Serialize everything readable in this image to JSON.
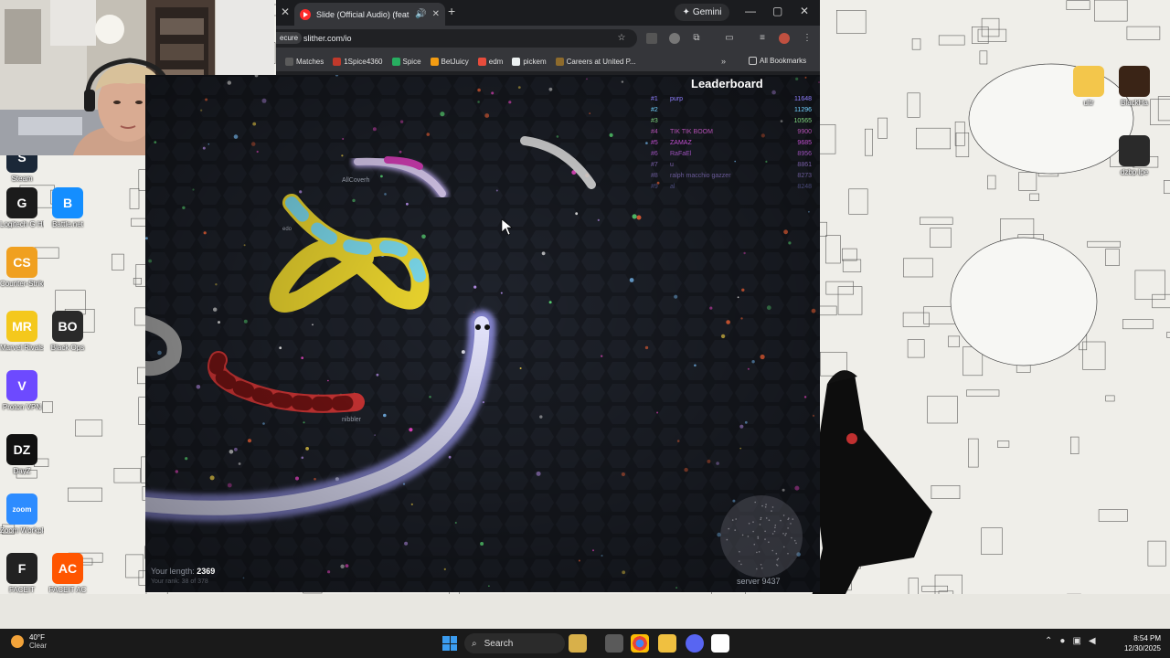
{
  "webcam": {
    "label": "webcam overlay"
  },
  "desktop_icons": [
    {
      "label": "Steam",
      "color": "#1b2838",
      "glyph": "S"
    },
    {
      "label": "Logitech G HUB",
      "color": "#1b1b1b",
      "glyph": "G"
    },
    {
      "label": "Battle.net",
      "color": "#148eff",
      "glyph": "B"
    },
    {
      "label": "Counter-Strike 2",
      "color": "#f0a020",
      "glyph": "CS"
    },
    {
      "label": "Marvel Rivals",
      "color": "#f4c81c",
      "glyph": "MR"
    },
    {
      "label": "Black Ops",
      "color": "#2a2a2a",
      "glyph": "BO"
    },
    {
      "label": "Proton VPN",
      "color": "#6d4aff",
      "glyph": "V"
    },
    {
      "label": "DayZ",
      "color": "#111111",
      "glyph": "DZ"
    },
    {
      "label": "Zoom Workplace",
      "color": "#2d8cff",
      "glyph": "zoom"
    },
    {
      "label": "FACEIT",
      "color": "#222222",
      "glyph": "F"
    },
    {
      "label": "FACEIT AC",
      "color": "#ff5500",
      "glyph": "AC"
    }
  ],
  "right_icons": [
    {
      "label": "ultr",
      "color": "#f3c64b"
    },
    {
      "label": "BlackHa",
      "color": "#3a2416"
    },
    {
      "label": "dzbp.lpe",
      "color": "#2a2a2a"
    }
  ],
  "browser": {
    "tab_title": "Slide (Official Audio) (feat.",
    "gemini_label": "Gemini",
    "not_secure": "ecure",
    "url": "slither.com/io",
    "bookmarks": [
      {
        "label": "Matches",
        "color": "#5b5b5b"
      },
      {
        "label": "1Spice4360",
        "color": "#c0392b"
      },
      {
        "label": "Spice",
        "color": "#27ae60"
      },
      {
        "label": "BetJuicy",
        "color": "#f39c12"
      },
      {
        "label": "edm",
        "color": "#e74c3c"
      },
      {
        "label": "pickem",
        "color": "#ecf0f1"
      },
      {
        "label": "Careers at United P...",
        "color": "#8e6b2c"
      }
    ],
    "all_bookmarks": "All Bookmarks"
  },
  "game": {
    "leaderboard_title": "Leaderboard",
    "leaderboard": [
      {
        "rank": "#1",
        "name": "purp",
        "score": "11648",
        "color": "#8f7fff"
      },
      {
        "rank": "#2",
        "name": "",
        "score": "11296",
        "color": "#6fd1ff"
      },
      {
        "rank": "#3",
        "name": "",
        "score": "10565",
        "color": "#7fd47f"
      },
      {
        "rank": "#4",
        "name": "TIK TIK BOOM",
        "score": "9900",
        "color": "#b14fb1"
      },
      {
        "rank": "#5",
        "name": "ZAMAZ",
        "score": "9685",
        "color": "#c04fd0"
      },
      {
        "rank": "#6",
        "name": "RaFaEl",
        "score": "8956",
        "color": "#9a4fb8"
      },
      {
        "rank": "#7",
        "name": "u",
        "score": "8861",
        "color": "#7a5fa8"
      },
      {
        "rank": "#8",
        "name": "ralph macchio gazzer",
        "score": "8273",
        "color": "#6a5a98"
      },
      {
        "rank": "#9",
        "name": "al",
        "score": "8248",
        "color": "#4a4a7a"
      }
    ],
    "your_length_label": "Your length:",
    "your_length": "2369",
    "your_rank": "Your rank: 38 of 378",
    "server": "server 9437",
    "snake_names": {
      "allcoverh": "AllCoverh",
      "nibbler": "nibbler",
      "edo": "edo"
    }
  },
  "taskbar": {
    "weather_temp": "40°F",
    "weather_desc": "Clear",
    "search_label": "Search",
    "time": "8:54 PM",
    "date": "12/30/2025"
  }
}
